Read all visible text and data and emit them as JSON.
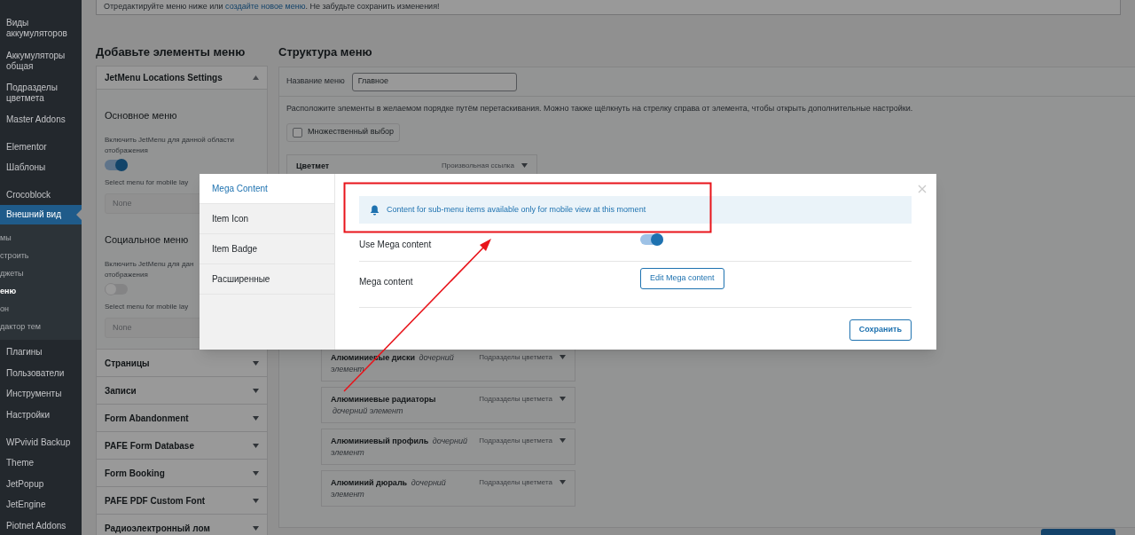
{
  "sidebar": {
    "items": [
      {
        "label": "Виды\nаккумуляторов",
        "selected": false
      },
      {
        "label": "Аккумуляторы\nобщая",
        "selected": false
      },
      {
        "label": "Подразделы\nцветмета",
        "selected": false
      },
      {
        "label": "Master Addons",
        "selected": false
      },
      {
        "label": "Elementor",
        "selected": false
      },
      {
        "label": "Шаблоны",
        "selected": false
      },
      {
        "label": "Crocoblock",
        "selected": false
      },
      {
        "label": "Внешний вид",
        "selected": true,
        "children": [
          {
            "label": "мы",
            "selected": false
          },
          {
            "label": "строить",
            "selected": false
          },
          {
            "label": "джеты",
            "selected": false
          },
          {
            "label": "еню",
            "selected": true
          },
          {
            "label": "он",
            "selected": false
          },
          {
            "label": "дактор тем",
            "selected": false
          }
        ]
      },
      {
        "label": "Плагины",
        "selected": false
      },
      {
        "label": "Пользователи",
        "selected": false
      },
      {
        "label": "Инструменты",
        "selected": false
      },
      {
        "label": "Настройки",
        "selected": false
      },
      {
        "label": "WPvivid Backup",
        "selected": false
      },
      {
        "label": "Theme",
        "selected": false
      },
      {
        "label": "JetPopup",
        "selected": false
      },
      {
        "label": "JetEngine",
        "selected": false
      },
      {
        "label": "Piotnet Addons",
        "selected": false
      }
    ]
  },
  "notice": {
    "before": "Отредактируйте меню ниже или ",
    "link": "создайте новое меню",
    "after": ". Не забудьте сохранить изменения!"
  },
  "add_items": {
    "heading": "Добавьте элементы меню",
    "sections": [
      {
        "title": "JetMenu Locations Settings",
        "expanded": true,
        "locations": [
          {
            "title": "Основное меню",
            "toggle_label": "Включить JetMenu для данной области отображения",
            "on": true,
            "select_label": "Select menu for mobile lay",
            "select_value": "None"
          },
          {
            "title": "Социальное меню",
            "toggle_label": "Включить JetMenu для дан\nотображения",
            "on": false,
            "select_label": "Select menu for mobile lay",
            "select_value": "None"
          }
        ]
      },
      {
        "title": "Страницы",
        "expanded": false
      },
      {
        "title": "Записи",
        "expanded": false
      },
      {
        "title": "Form Abandonment",
        "expanded": false
      },
      {
        "title": "PAFE Form Database",
        "expanded": false
      },
      {
        "title": "Form Booking",
        "expanded": false
      },
      {
        "title": "PAFE PDF Custom Font",
        "expanded": false
      },
      {
        "title": "Радиоэлектронный лом",
        "expanded": false
      }
    ]
  },
  "structure": {
    "heading": "Структура меню",
    "name_label": "Название меню",
    "name_value": "Главное",
    "hint": "Расположите элементы в желаемом порядке путём перетаскивания. Можно также щёлкнуть на стрелку справа от элемента, чтобы открыть дополнительные настройки.",
    "bulk_select": {
      "label": "Множественный выбор",
      "checked": false
    },
    "items": [
      {
        "title": "Цветмет",
        "type": "Произвольная ссылка",
        "children": [
          {
            "title": "Алюминиевые диски",
            "subtitle": "дочерний элемент",
            "type": "Подразделы цветмета"
          },
          {
            "title": "Алюминиевые радиаторы",
            "subtitle": "дочерний элемент",
            "type": "Подразделы цветмета"
          },
          {
            "title": "Алюминиевый профиль",
            "subtitle": "дочерний элемент",
            "type": "Подразделы цветмета"
          },
          {
            "title": "Алюминий дюраль",
            "subtitle": "дочерний элемент",
            "type": "Подразделы цветмета"
          }
        ]
      }
    ]
  },
  "modal": {
    "tabs": [
      {
        "label": "Mega Content",
        "selected": true
      },
      {
        "label": "Item Icon",
        "selected": false
      },
      {
        "label": "Item Badge",
        "selected": false
      },
      {
        "label": "Расширенные",
        "selected": false
      }
    ],
    "alert": "Content for sub-menu items available only for mobile view at this moment",
    "settings": [
      {
        "kind": "toggle",
        "label": "Use Mega content",
        "on": true
      },
      {
        "kind": "button",
        "label": "Mega content",
        "button": "Edit Mega content"
      }
    ],
    "save": "Сохранить"
  }
}
